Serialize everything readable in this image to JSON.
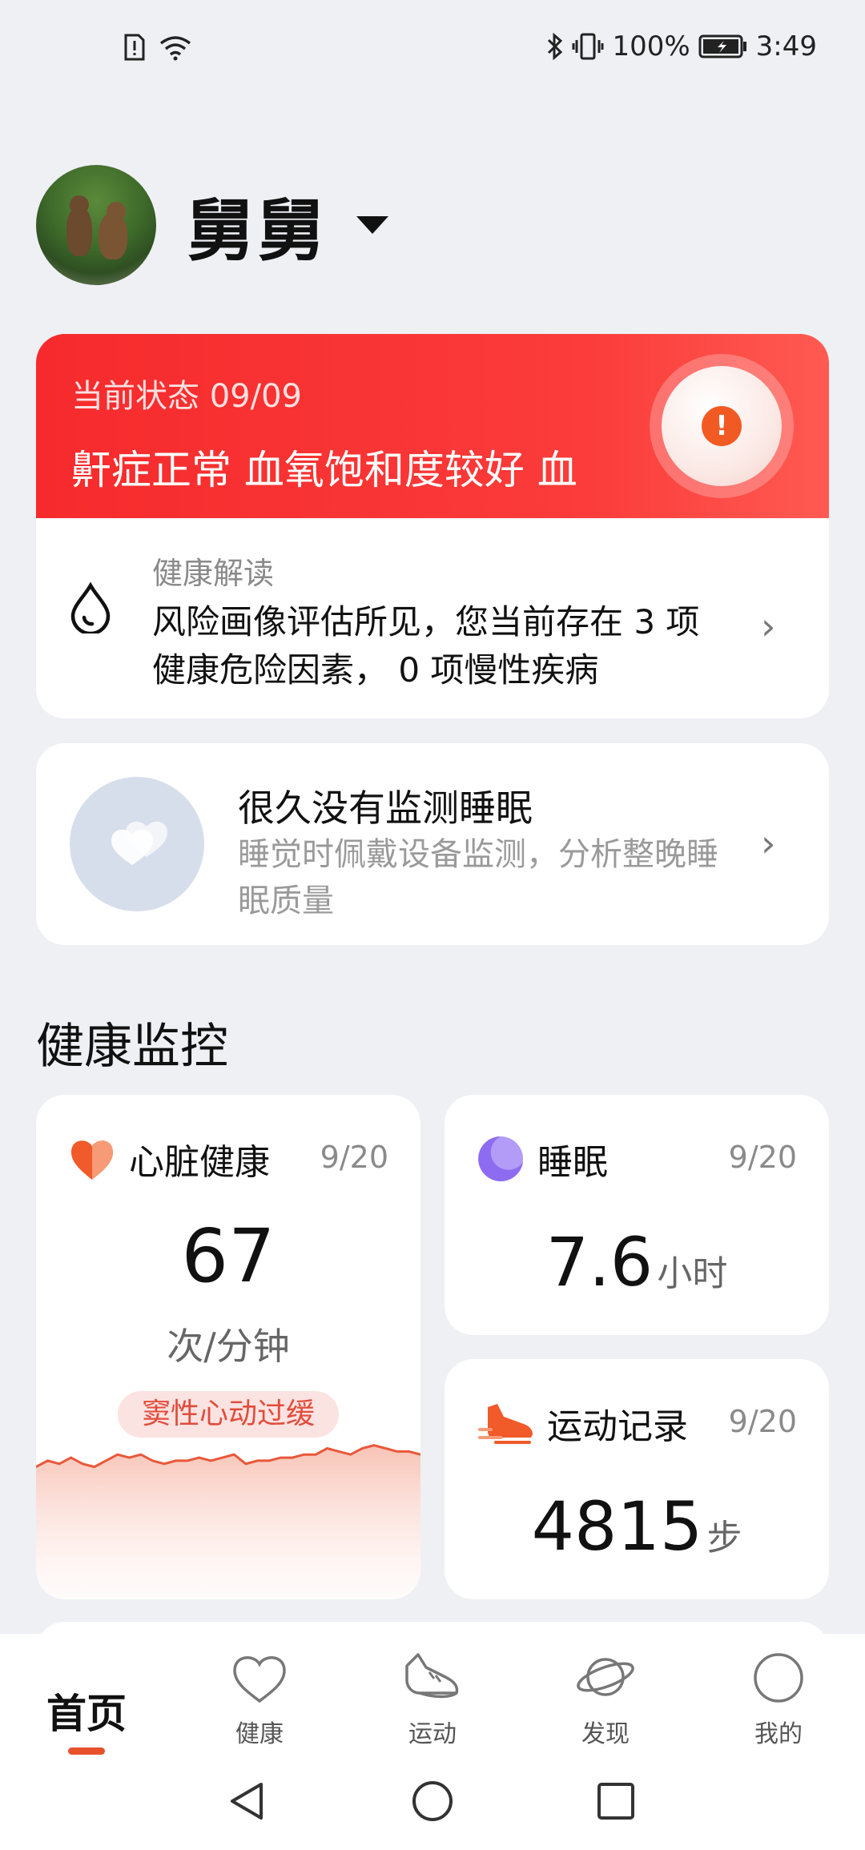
{
  "status_bar": {
    "battery_percent": "100%",
    "time": "3:49"
  },
  "profile": {
    "name": "舅舅"
  },
  "health_status": {
    "label": "当前状态 09/09",
    "scroll_text": "鼾症正常 血氧饱和度较好 血",
    "interpretation_title": "健康解读",
    "interpretation_body": "风险画像评估所见，您当前存在 3 项健康危险因素， 0 项慢性疾病"
  },
  "sleep_prompt": {
    "title": "很久没有监测睡眠",
    "subtitle": "睡觉时佩戴设备监测，分析整晚睡眠质量"
  },
  "monitor": {
    "section_title": "健康监控",
    "heart": {
      "title": "心脏健康",
      "date": "9/20",
      "value": "67",
      "unit": "次/分钟",
      "badge": "窦性心动过缓",
      "trend": [
        62,
        64,
        63,
        65,
        63,
        62,
        64,
        66,
        65,
        66,
        64,
        63,
        64,
        64,
        65,
        64,
        65,
        66,
        63,
        64,
        64,
        65,
        65,
        66,
        66,
        68,
        67,
        66,
        68,
        69,
        68,
        67,
        67,
        66
      ]
    },
    "sleep": {
      "title": "睡眠",
      "date": "9/20",
      "value": "7.6",
      "unit": "小时"
    },
    "exercise": {
      "title": "运动记录",
      "date": "9/20",
      "value": "4815",
      "unit": "步"
    }
  },
  "bottom_nav": {
    "home": "首页",
    "health": "健康",
    "exercise": "运动",
    "discover": "发现",
    "mine": "我的"
  },
  "colors": {
    "accent_red": "#f62a2c",
    "accent_orange": "#e8502c",
    "sleep_purple": "#8d6cf2"
  }
}
